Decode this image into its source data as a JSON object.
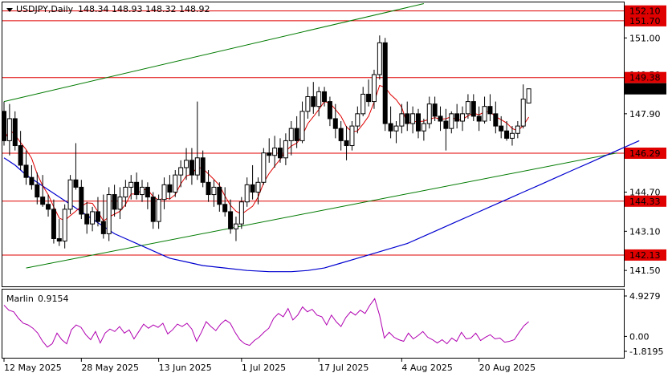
{
  "header": {
    "symbol": "USDJPY,Daily",
    "ohlc": "148.34 148.93 148.32 148.92"
  },
  "indicator": {
    "name": "Marlin",
    "value": "0.9154",
    "scale_labels": [
      "4.9279",
      "0.00",
      "-1.8195"
    ],
    "ylim": [
      -1.8195,
      4.9279
    ],
    "line_color": "#b000b0",
    "values": [
      3.8,
      3.2,
      3.0,
      2.2,
      1.6,
      1.4,
      1.0,
      0.4,
      -0.6,
      -1.3,
      -0.9,
      0.4,
      -0.4,
      -0.9,
      0.8,
      1.4,
      1.1,
      0.2,
      -0.4,
      0.6,
      -0.8,
      0.4,
      0.9,
      0.6,
      1.2,
      0.4,
      0.8,
      -0.3,
      0.6,
      1.5,
      1.0,
      1.4,
      1.1,
      1.6,
      0.3,
      0.8,
      1.5,
      1.2,
      1.6,
      0.9,
      -0.6,
      0.5,
      1.8,
      1.2,
      0.7,
      1.5,
      2.0,
      1.6,
      0.5,
      -0.4,
      -0.9,
      -1.1,
      -0.5,
      -0.1,
      0.5,
      1.0,
      2.2,
      2.8,
      2.4,
      3.4,
      2.0,
      2.6,
      3.6,
      3.0,
      3.3,
      2.6,
      2.4,
      1.4,
      2.6,
      1.8,
      1.2,
      2.3,
      3.0,
      2.6,
      3.2,
      2.8,
      3.8,
      4.6,
      2.6,
      -0.2,
      0.5,
      -0.1,
      -0.4,
      -0.6,
      0.4,
      -0.3,
      0.1,
      0.6,
      -0.1,
      -0.4,
      -0.8,
      -0.4,
      -0.9,
      -0.2,
      -0.6,
      0.5,
      -0.3,
      -0.2,
      0.4,
      -0.5,
      -0.1,
      0.2,
      -0.3,
      -0.2,
      -0.7,
      -0.6,
      -0.4,
      0.5,
      1.3,
      1.8
    ]
  },
  "price_labels": [
    "152.10",
    "151.70",
    "151.00",
    "149.50",
    "149.38",
    "148.92",
    "147.90",
    "146.29",
    "144.70",
    "144.33",
    "143.10",
    "142.13",
    "141.50"
  ],
  "x_labels": [
    "12 May 2025",
    "28 May 2025",
    "13 Jun 2025",
    "1 Jul 2025",
    "17 Jul 2025",
    "4 Aug 2025",
    "20 Aug 2025"
  ],
  "colors": {
    "level": "#e00000",
    "channel": "#007a00",
    "ma_fast": "#e00000",
    "ma_slow": "#0000d0",
    "current_price_tag": "#000000",
    "level_tag_bg": "#e00000"
  },
  "chart_data": {
    "type": "candlestick",
    "title": "USDJPY,Daily",
    "ylim": [
      140.8,
      152.5
    ],
    "levels": [
      152.1,
      151.7,
      149.38,
      146.29,
      144.33,
      142.13
    ],
    "current_price": 148.92,
    "channel_lines": [
      {
        "points": [
          [
            0,
            148.4
          ],
          [
            76,
            152.4
          ]
        ]
      },
      {
        "points": [
          [
            4,
            141.6
          ],
          [
            111,
            146.3
          ]
        ]
      }
    ],
    "ma_slow": [
      146.1,
      145.8,
      145.4,
      145.1,
      144.8,
      144.5,
      144.2,
      143.9,
      143.6,
      143.3,
      143.0,
      142.8,
      142.6,
      142.4,
      142.2,
      142.0,
      141.85,
      141.7,
      141.6,
      141.5,
      141.45,
      141.45,
      141.5,
      141.6,
      141.8,
      142.0,
      142.2,
      142.4,
      142.6,
      142.9,
      143.2,
      143.5,
      143.8,
      144.1,
      144.4,
      144.7,
      145.0,
      145.3,
      145.6,
      145.9,
      146.2,
      146.5,
      146.8
    ],
    "ma_slow_x": [
      0,
      2,
      4,
      6,
      8,
      10,
      12,
      14,
      16,
      18,
      20,
      22,
      24,
      26,
      28,
      30,
      33,
      36,
      40,
      44,
      48,
      52,
      55,
      58,
      61,
      64,
      67,
      70,
      73,
      76,
      79,
      82,
      85,
      88,
      91,
      94,
      97,
      100,
      103,
      106,
      109,
      112,
      115
    ],
    "candles": [
      [
        148.0,
        148.4,
        146.6,
        146.8
      ],
      [
        146.8,
        148.3,
        146.2,
        147.7
      ],
      [
        147.7,
        148.0,
        146.4,
        146.6
      ],
      [
        146.6,
        147.2,
        145.6,
        145.8
      ],
      [
        145.8,
        146.4,
        145.0,
        145.3
      ],
      [
        145.3,
        145.8,
        144.8,
        145.0
      ],
      [
        145.0,
        145.5,
        144.2,
        144.5
      ],
      [
        144.5,
        145.4,
        144.1,
        144.2
      ],
      [
        144.2,
        144.6,
        143.7,
        144.0
      ],
      [
        144.0,
        144.4,
        142.6,
        142.8
      ],
      [
        142.8,
        143.6,
        142.5,
        142.7
      ],
      [
        142.7,
        144.2,
        142.4,
        144.0
      ],
      [
        144.0,
        145.4,
        143.8,
        145.2
      ],
      [
        145.2,
        146.7,
        144.8,
        144.9
      ],
      [
        144.9,
        145.2,
        143.6,
        143.8
      ],
      [
        143.8,
        144.3,
        143.0,
        143.4
      ],
      [
        143.4,
        144.1,
        143.1,
        143.9
      ],
      [
        143.9,
        144.5,
        143.3,
        143.5
      ],
      [
        143.5,
        144.6,
        142.8,
        143.0
      ],
      [
        143.0,
        144.9,
        142.7,
        144.6
      ],
      [
        144.6,
        145.0,
        143.7,
        144.0
      ],
      [
        144.0,
        144.9,
        143.6,
        144.5
      ],
      [
        144.5,
        145.2,
        144.1,
        144.9
      ],
      [
        144.9,
        145.4,
        144.4,
        145.1
      ],
      [
        145.1,
        145.5,
        144.4,
        144.6
      ],
      [
        144.6,
        145.2,
        144.3,
        144.9
      ],
      [
        144.9,
        145.1,
        144.0,
        144.5
      ],
      [
        144.5,
        144.7,
        143.2,
        143.5
      ],
      [
        143.5,
        144.6,
        143.2,
        144.4
      ],
      [
        144.4,
        145.3,
        144.0,
        145.0
      ],
      [
        145.0,
        145.4,
        144.4,
        144.7
      ],
      [
        144.7,
        145.6,
        144.5,
        145.4
      ],
      [
        145.4,
        146.0,
        144.9,
        145.7
      ],
      [
        145.7,
        146.5,
        145.2,
        146.0
      ],
      [
        146.0,
        146.5,
        145.0,
        145.4
      ],
      [
        145.4,
        148.4,
        145.2,
        146.1
      ],
      [
        146.1,
        146.4,
        144.9,
        145.1
      ],
      [
        145.1,
        145.6,
        144.3,
        144.6
      ],
      [
        144.6,
        145.2,
        144.1,
        144.9
      ],
      [
        144.9,
        145.1,
        143.9,
        144.2
      ],
      [
        144.2,
        144.9,
        143.7,
        143.9
      ],
      [
        143.9,
        144.4,
        143.0,
        143.2
      ],
      [
        143.2,
        143.7,
        142.7,
        143.4
      ],
      [
        143.4,
        144.5,
        143.2,
        144.3
      ],
      [
        144.3,
        145.3,
        144.1,
        145.0
      ],
      [
        145.0,
        145.8,
        144.4,
        144.7
      ],
      [
        144.7,
        145.3,
        144.2,
        145.1
      ],
      [
        145.1,
        146.5,
        145.0,
        146.3
      ],
      [
        146.3,
        146.9,
        145.9,
        146.2
      ],
      [
        146.2,
        147.0,
        145.7,
        146.5
      ],
      [
        146.5,
        146.9,
        145.9,
        146.1
      ],
      [
        146.1,
        147.1,
        145.8,
        146.8
      ],
      [
        146.8,
        147.6,
        146.2,
        147.3
      ],
      [
        147.3,
        147.8,
        146.5,
        146.8
      ],
      [
        146.8,
        148.4,
        146.7,
        148.0
      ],
      [
        148.0,
        149.0,
        147.7,
        148.6
      ],
      [
        148.6,
        149.2,
        147.9,
        148.2
      ],
      [
        148.2,
        149.0,
        147.8,
        148.8
      ],
      [
        148.8,
        149.0,
        148.2,
        148.4
      ],
      [
        148.4,
        148.6,
        147.4,
        147.7
      ],
      [
        147.7,
        148.3,
        146.9,
        147.3
      ],
      [
        147.3,
        147.6,
        146.4,
        146.8
      ],
      [
        146.8,
        147.4,
        146.0,
        146.6
      ],
      [
        146.6,
        147.6,
        146.4,
        147.4
      ],
      [
        147.4,
        148.2,
        147.1,
        147.9
      ],
      [
        147.9,
        149.0,
        147.8,
        148.7
      ],
      [
        148.7,
        149.3,
        148.2,
        148.4
      ],
      [
        148.4,
        149.7,
        148.1,
        149.5
      ],
      [
        149.5,
        151.1,
        149.3,
        150.8
      ],
      [
        150.8,
        151.0,
        147.2,
        147.5
      ],
      [
        147.5,
        148.2,
        146.9,
        147.2
      ],
      [
        147.2,
        147.6,
        146.7,
        147.4
      ],
      [
        147.4,
        148.3,
        147.1,
        147.9
      ],
      [
        147.9,
        148.4,
        147.2,
        147.5
      ],
      [
        147.5,
        148.2,
        147.1,
        147.9
      ],
      [
        147.9,
        148.1,
        146.9,
        147.2
      ],
      [
        147.2,
        147.7,
        146.8,
        147.5
      ],
      [
        147.5,
        148.6,
        147.3,
        148.3
      ],
      [
        148.3,
        148.6,
        147.6,
        147.8
      ],
      [
        147.8,
        148.2,
        147.2,
        147.6
      ],
      [
        147.6,
        148.1,
        146.4,
        147.3
      ],
      [
        147.3,
        148.0,
        147.1,
        147.9
      ],
      [
        147.9,
        148.3,
        147.3,
        147.6
      ],
      [
        147.6,
        148.2,
        147.2,
        147.9
      ],
      [
        147.9,
        148.7,
        147.7,
        148.4
      ],
      [
        148.4,
        148.7,
        147.6,
        147.8
      ],
      [
        147.8,
        148.2,
        147.2,
        147.6
      ],
      [
        147.6,
        148.6,
        147.5,
        148.2
      ],
      [
        148.2,
        148.7,
        147.6,
        147.9
      ],
      [
        147.9,
        148.4,
        147.1,
        147.4
      ],
      [
        147.4,
        147.8,
        146.9,
        147.2
      ],
      [
        147.2,
        147.6,
        146.8,
        146.9
      ],
      [
        146.9,
        147.4,
        146.6,
        147.1
      ],
      [
        147.1,
        147.6,
        146.9,
        147.4
      ],
      [
        147.4,
        149.1,
        147.3,
        148.5
      ],
      [
        148.34,
        148.93,
        148.32,
        148.92
      ]
    ]
  }
}
